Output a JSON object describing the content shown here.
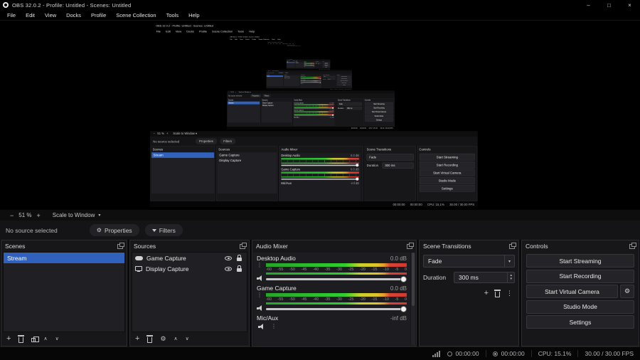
{
  "window": {
    "title": "OBS 32.0.2 - Profile: Untitled - Scenes: Untitled"
  },
  "icons": {
    "minimize": "–",
    "maximize": "□",
    "close": "×",
    "add": "+",
    "options": "⋮",
    "gear": "⚙",
    "up": "∧",
    "down": "∨",
    "caret": "▾",
    "spin_up": "▴",
    "spin_down": "▾"
  },
  "menu": {
    "items": [
      "File",
      "Edit",
      "View",
      "Docks",
      "Profile",
      "Scene Collection",
      "Tools",
      "Help"
    ]
  },
  "preview_toolbar": {
    "zoom_out": "−",
    "zoom_value": "51 %",
    "zoom_in": "+",
    "scale_mode": "Scale to Window"
  },
  "source_toolbar": {
    "status": "No source selected",
    "properties": "Properties",
    "filters": "Filters"
  },
  "docks": {
    "scenes": {
      "title": "Scenes",
      "items": [
        {
          "name": "Stream",
          "selected": true
        }
      ]
    },
    "sources": {
      "title": "Sources",
      "items": [
        {
          "name": "Game Capture",
          "icon": "gamepad-icon",
          "visible": true,
          "locked": true
        },
        {
          "name": "Display Capture",
          "icon": "monitor-icon",
          "visible": true,
          "locked": true
        }
      ]
    },
    "mixer": {
      "title": "Audio Mixer",
      "ticks": [
        "-60",
        "-55",
        "-50",
        "-45",
        "-40",
        "-35",
        "-30",
        "-25",
        "-20",
        "-15",
        "-10",
        "-5",
        "0"
      ],
      "channels": [
        {
          "name": "Desktop Audio",
          "db": "0.0 dB"
        },
        {
          "name": "Game Capture",
          "db": "0.0 dB"
        },
        {
          "name": "Mic/Aux",
          "db": "-inf dB"
        }
      ]
    },
    "transitions": {
      "title": "Scene Transitions",
      "selected": "Fade",
      "duration_label": "Duration",
      "duration_value": "300 ms"
    },
    "controls": {
      "title": "Controls",
      "buttons": [
        "Start Streaming",
        "Start Recording",
        "Start Virtual Camera",
        "Studio Mode",
        "Settings"
      ]
    }
  },
  "status_bar": {
    "stream_time": "00:00:00",
    "rec_time": "00:00:00",
    "cpu": "CPU: 15.1%",
    "fps": "30.00 / 30.00 FPS"
  },
  "colors": {
    "accent": "#3061bd",
    "meter_green": "#2fcf2e",
    "meter_yellow": "#e0c22b",
    "meter_red": "#d03a31"
  }
}
